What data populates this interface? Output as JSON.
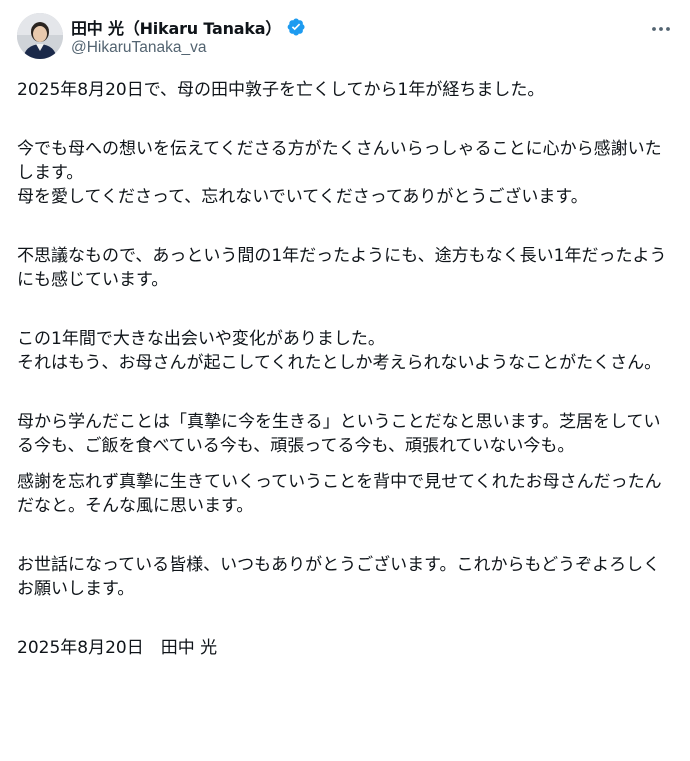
{
  "author": {
    "display_name": "田中 光（Hikaru Tanaka）",
    "handle": "@HikaruTanaka_va",
    "verified": true,
    "verified_color": "#1d9bf0"
  },
  "menu_icon": "more-horizontal-icon",
  "post": {
    "paragraphs": [
      "2025年8月20日で、母の田中敦子を亡くしてから1年が経ちました。",
      "今でも母への想いを伝えてくださる方がたくさんいらっしゃることに心から感謝いたします。\n母を愛してくださって、忘れないでいてくださってありがとうございます。",
      "不思議なもので、あっという間の1年だったようにも、途方もなく長い1年だったようにも感じています。",
      "この1年間で大きな出会いや変化がありました。\nそれはもう、お母さんが起こしてくれたとしか考えられないようなことがたくさん。",
      "母から学んだことは「真摯に今を生きる」ということだなと思います。芝居をしている今も、ご飯を食べている今も、頑張ってる今も、頑張れていない今も。",
      "感謝を忘れず真摯に生きていくっていうことを背中で見せてくれたお母さんだったんだなと。そんな風に思います。",
      "お世話になっている皆様、いつもありがとうございます。これからもどうぞよろしくお願いします。",
      "2025年8月20日　田中 光"
    ]
  }
}
